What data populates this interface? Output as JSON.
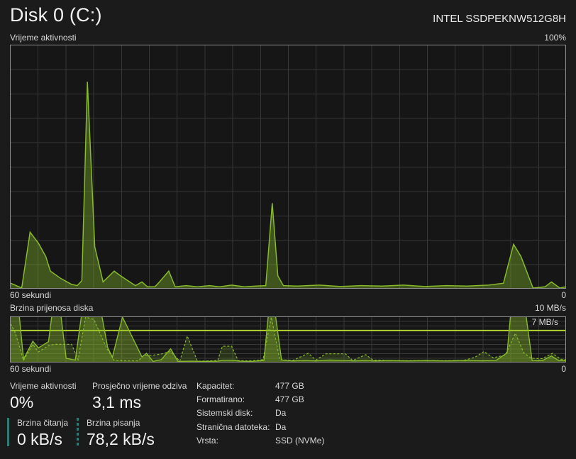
{
  "header": {
    "title": "Disk 0 (C:)",
    "device": "INTEL SSDPEKNW512G8H"
  },
  "activity": {
    "title": "Vrijeme aktivnosti",
    "ymax_label": "100%",
    "x_left_label": "60 sekundi",
    "x_right_label": "0"
  },
  "transfer": {
    "title": "Brzina prijenosa diska",
    "ymax_label": "10 MB/s",
    "threshold_label": "7 MB/s",
    "x_left_label": "60 sekundi",
    "x_right_label": "0"
  },
  "stats": {
    "active_time": {
      "label": "Vrijeme aktivnosti",
      "value": "0%"
    },
    "response_time": {
      "label": "Prosječno vrijeme odziva",
      "value": "3,1 ms"
    },
    "read_speed": {
      "label": "Brzina čitanja",
      "value": "0 kB/s"
    },
    "write_speed": {
      "label": "Brzina pisanja",
      "value": "78,2 kB/s"
    }
  },
  "details": [
    {
      "label": "Kapacitet:",
      "value": "477 GB"
    },
    {
      "label": "Formatirano:",
      "value": "477 GB"
    },
    {
      "label": "Sistemski disk:",
      "value": "Da"
    },
    {
      "label": "Stranična datoteka:",
      "value": "Da"
    },
    {
      "label": "Vrsta:",
      "value": "SSD (NVMe)"
    }
  ],
  "colors": {
    "page-bg": "#1b1b1b",
    "chart-bg": "#161616",
    "grid": "#373737",
    "chart-border": "#8f8f8f",
    "green": "#87ba2c",
    "threshold": "#b4d331",
    "teal": "#2e7d74",
    "text-dim": "#d8d8d8",
    "text-bright": "#f2f2f2"
  },
  "chart_data": [
    {
      "type": "area",
      "title": "Vrijeme aktivnosti (disk active time %)",
      "xlabel": "60 sekundi → 0",
      "ylabel": "%",
      "ylim": [
        0,
        100
      ],
      "x_range": 60,
      "grid": true,
      "points": [
        [
          0,
          2
        ],
        [
          1.2,
          0
        ],
        [
          2.1,
          23
        ],
        [
          3,
          18.5
        ],
        [
          3.8,
          13
        ],
        [
          4.3,
          7
        ],
        [
          5.4,
          4
        ],
        [
          6.6,
          1.5
        ],
        [
          7.2,
          1
        ],
        [
          7.7,
          3
        ],
        [
          8.3,
          85
        ],
        [
          9.1,
          17
        ],
        [
          10,
          2.5
        ],
        [
          11.2,
          7
        ],
        [
          11.9,
          5
        ],
        [
          13.1,
          2
        ],
        [
          13.5,
          1
        ],
        [
          14.2,
          2.5
        ],
        [
          14.8,
          0.5
        ],
        [
          15.6,
          0.5
        ],
        [
          16.1,
          2.5
        ],
        [
          17.1,
          7
        ],
        [
          17.8,
          0.5
        ],
        [
          19,
          1
        ],
        [
          20.2,
          0.5
        ],
        [
          21.5,
          1
        ],
        [
          22.6,
          0.5
        ],
        [
          23.9,
          1.2
        ],
        [
          25.3,
          0.5
        ],
        [
          26.5,
          0.8
        ],
        [
          27.6,
          1
        ],
        [
          28.3,
          35
        ],
        [
          28.9,
          5
        ],
        [
          29.5,
          1
        ],
        [
          31,
          0.8
        ],
        [
          33.4,
          1.2
        ],
        [
          35.7,
          0.6
        ],
        [
          37.9,
          1
        ],
        [
          40.2,
          0.8
        ],
        [
          42.5,
          1.2
        ],
        [
          44.8,
          0.6
        ],
        [
          47.1,
          1
        ],
        [
          49.4,
          0.8
        ],
        [
          51.7,
          1.2
        ],
        [
          53.3,
          2
        ],
        [
          54.4,
          18
        ],
        [
          55.2,
          13
        ],
        [
          56.5,
          0
        ],
        [
          57.8,
          0.5
        ],
        [
          58.5,
          2.5
        ],
        [
          59.4,
          0
        ],
        [
          60,
          0.5
        ]
      ]
    },
    {
      "type": "area",
      "title": "Brzina prijenosa diska (MB/s)",
      "xlabel": "60 sekundi → 0",
      "ylabel": "MB/s",
      "ylim": [
        0,
        10
      ],
      "x_range": 60,
      "grid": true,
      "threshold": 7,
      "series": [
        {
          "name": "write-speed-solid",
          "points": [
            [
              0,
              11
            ],
            [
              0.9,
              11
            ],
            [
              1.4,
              0.6
            ],
            [
              2.4,
              4.6
            ],
            [
              3,
              3.1
            ],
            [
              4.1,
              4.5
            ],
            [
              4.5,
              11
            ],
            [
              5.4,
              11
            ],
            [
              6,
              0.8
            ],
            [
              7,
              0.4
            ],
            [
              7.7,
              11
            ],
            [
              9.8,
              11
            ],
            [
              10.5,
              3.2
            ],
            [
              11,
              1
            ],
            [
              12.1,
              10
            ],
            [
              14.2,
              1.1
            ],
            [
              14.7,
              1.9
            ],
            [
              15.4,
              0.1
            ],
            [
              16.3,
              0.5
            ],
            [
              17.3,
              2.9
            ],
            [
              18.1,
              0.1
            ],
            [
              19.5,
              0.15
            ],
            [
              21,
              0.1
            ],
            [
              22.4,
              0.15
            ],
            [
              23,
              0.35
            ],
            [
              24,
              0.35
            ],
            [
              24.8,
              0.15
            ],
            [
              26,
              0.1
            ],
            [
              27.4,
              0.3
            ],
            [
              27.9,
              11
            ],
            [
              28.6,
              11
            ],
            [
              29.3,
              0.4
            ],
            [
              30.5,
              0.2
            ],
            [
              31.8,
              0.3
            ],
            [
              33,
              0.2
            ],
            [
              34.5,
              0.4
            ],
            [
              36,
              0.3
            ],
            [
              37.2,
              0.2
            ],
            [
              38.4,
              0.3
            ],
            [
              39.5,
              0.2
            ],
            [
              41,
              0.3
            ],
            [
              43,
              0.2
            ],
            [
              45,
              0.3
            ],
            [
              47,
              0.2
            ],
            [
              49,
              0.3
            ],
            [
              51,
              0.25
            ],
            [
              52.5,
              0.3
            ],
            [
              53.7,
              2
            ],
            [
              54.1,
              11
            ],
            [
              55.7,
              11
            ],
            [
              56.4,
              0.3
            ],
            [
              57.5,
              0.25
            ],
            [
              58.5,
              1.3
            ],
            [
              59.3,
              0.25
            ],
            [
              60,
              0.3
            ]
          ]
        },
        {
          "name": "read-speed-dashed",
          "points": [
            [
              0,
              8.5
            ],
            [
              0.5,
              6.5
            ],
            [
              1.4,
              0.3
            ],
            [
              2.4,
              3.9
            ],
            [
              3,
              2.2
            ],
            [
              4.1,
              3.6
            ],
            [
              4.7,
              3.9
            ],
            [
              6.6,
              3.9
            ],
            [
              7.3,
              0.5
            ],
            [
              8.1,
              10
            ],
            [
              9,
              9.5
            ],
            [
              10.4,
              3
            ],
            [
              11.2,
              0.3
            ],
            [
              12.5,
              0.2
            ],
            [
              13.8,
              0.2
            ],
            [
              14.4,
              1.4
            ],
            [
              15.5,
              1.5
            ],
            [
              16.4,
              1.8
            ],
            [
              17.3,
              2.3
            ],
            [
              18.3,
              0.15
            ],
            [
              19.1,
              5.8
            ],
            [
              20.2,
              0.15
            ],
            [
              21.3,
              0.2
            ],
            [
              22.4,
              0.3
            ],
            [
              22.9,
              3.5
            ],
            [
              23.9,
              3.5
            ],
            [
              24.6,
              0.3
            ],
            [
              25.5,
              0.2
            ],
            [
              26.5,
              0.3
            ],
            [
              27.3,
              0.5
            ],
            [
              28.2,
              10
            ],
            [
              29.1,
              0.5
            ],
            [
              30.5,
              0.3
            ],
            [
              32.2,
              1.9
            ],
            [
              33,
              0.4
            ],
            [
              34.1,
              1.8
            ],
            [
              36.2,
              1.8
            ],
            [
              37,
              0.3
            ],
            [
              38.4,
              1.6
            ],
            [
              39.2,
              0.4
            ],
            [
              41,
              0.3
            ],
            [
              43,
              0.25
            ],
            [
              45,
              0.3
            ],
            [
              47,
              0.25
            ],
            [
              49,
              0.3
            ],
            [
              50.2,
              1
            ],
            [
              51.2,
              2.3
            ],
            [
              52.2,
              0.9
            ],
            [
              53.5,
              1.5
            ],
            [
              54.6,
              6.4
            ],
            [
              55.5,
              2
            ],
            [
              56.3,
              0.8
            ],
            [
              57.5,
              0.7
            ],
            [
              58.6,
              1.9
            ],
            [
              59.5,
              0.6
            ],
            [
              60,
              0.5
            ]
          ]
        }
      ]
    }
  ]
}
